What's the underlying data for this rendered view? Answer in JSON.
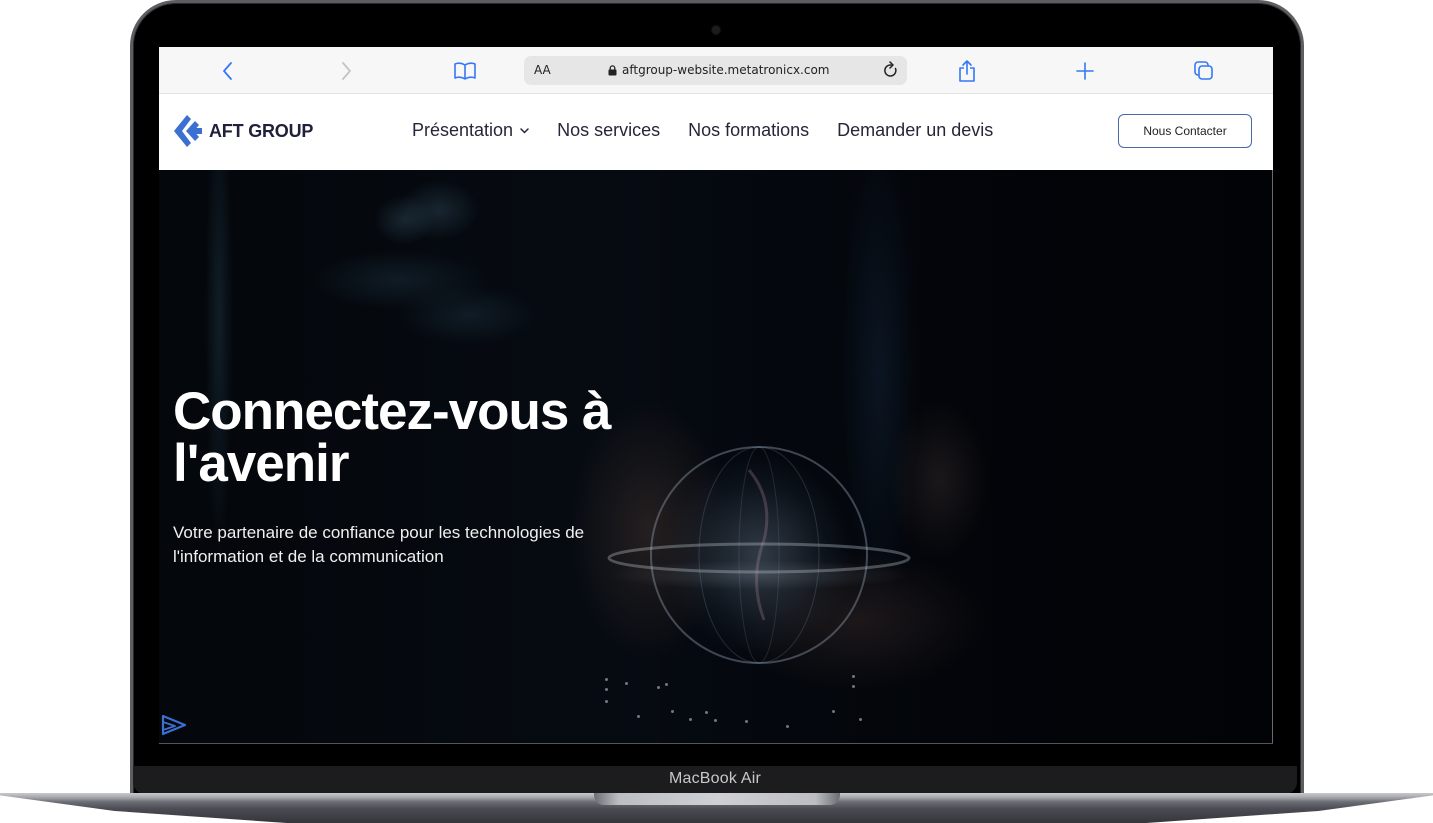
{
  "device": {
    "label": "MacBook Air"
  },
  "browser": {
    "toolbar": {
      "back_icon": "chevron-left-icon",
      "forward_icon": "chevron-right-icon",
      "bookmarks_icon": "book-icon",
      "text_size_label": "AA",
      "lock_icon": "lock-icon",
      "url": "aftgroup-website.metatronicx.com",
      "reload_icon": "reload-icon",
      "share_icon": "share-icon",
      "new_tab_icon": "plus-icon",
      "tabs_icon": "tabs-icon"
    },
    "accent_color": "#3478f6"
  },
  "site": {
    "logo": {
      "icon": "aft-logo-icon",
      "text": "AFT GROUP",
      "color": "#3b6fd1"
    },
    "nav": {
      "items": [
        {
          "label": "Présentation",
          "has_dropdown": true
        },
        {
          "label": "Nos services",
          "has_dropdown": false
        },
        {
          "label": "Nos formations",
          "has_dropdown": false
        },
        {
          "label": "Demander un devis",
          "has_dropdown": false
        }
      ],
      "cta_label": "Nous Contacter"
    },
    "hero": {
      "title": "Connectez-vous à l'avenir",
      "subtitle": "Votre partenaire de confiance pour les technologies de l'information et de la communication",
      "corner_icon": "play-icon"
    }
  }
}
